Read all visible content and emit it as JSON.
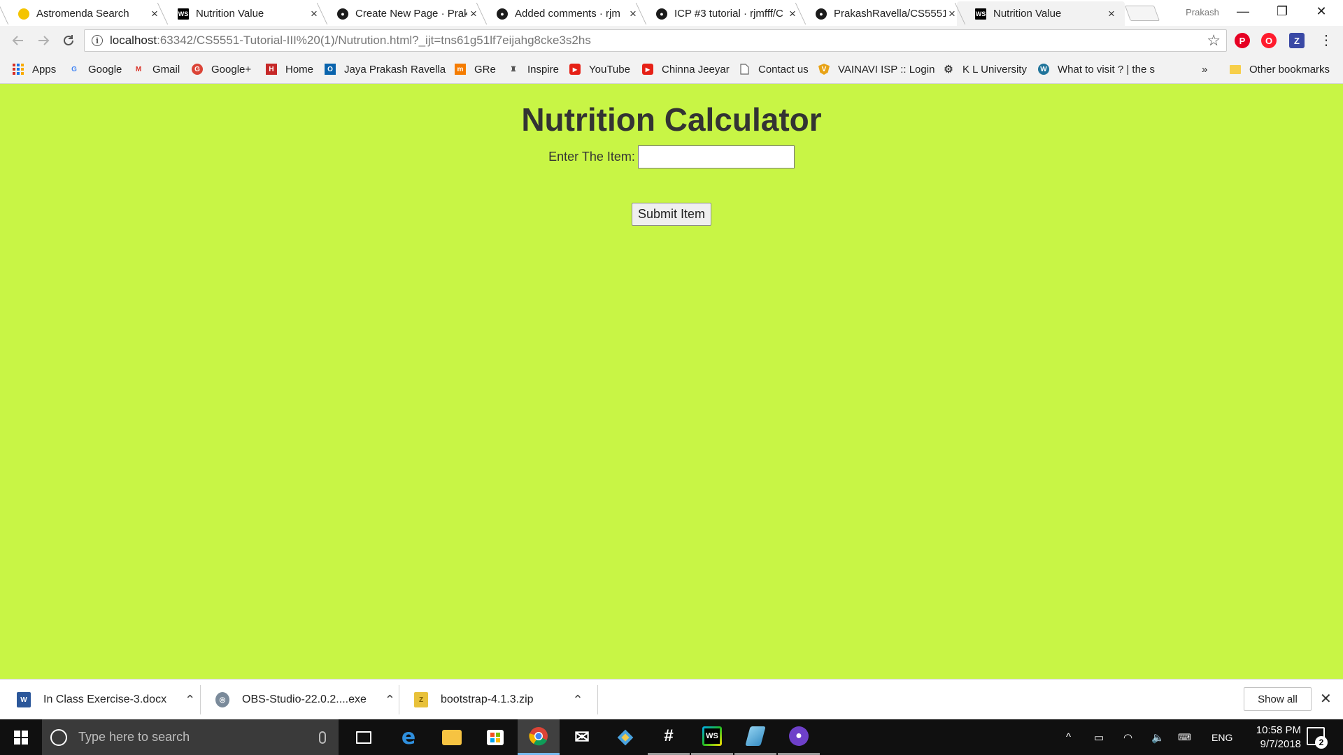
{
  "browser": {
    "tabs": [
      {
        "title": "Astromenda Search",
        "favicon": "astromenda-icon",
        "active": false
      },
      {
        "title": "Nutrition Value",
        "favicon": "webstorm-icon",
        "active": false
      },
      {
        "title": "Create New Page · Prak",
        "favicon": "github-icon",
        "active": false
      },
      {
        "title": "Added comments · rjm",
        "favicon": "github-icon",
        "active": false
      },
      {
        "title": "ICP #3 tutorial · rjmfff/C",
        "favicon": "github-icon",
        "active": false
      },
      {
        "title": "PrakashRavella/CS5551",
        "favicon": "github-icon",
        "active": false
      },
      {
        "title": "Nutrition Value",
        "favicon": "webstorm-icon",
        "active": true
      }
    ],
    "tab_close": "×",
    "profile_name": "Prakash",
    "window_controls": {
      "minimize": "—",
      "restore": "❐",
      "close": "✕"
    },
    "url": {
      "host": "localhost",
      "rest": ":63342/CS5551-Tutorial-III%20(1)/Nutrution.html?_ijt=tns61g51lf7eijahg8cke3s2hs"
    }
  },
  "bookmarks": [
    {
      "label": "Apps",
      "icon": "apps-grid-icon"
    },
    {
      "label": "Google",
      "icon": "google-icon",
      "color": "#4285f4",
      "glyph": "G"
    },
    {
      "label": "Gmail",
      "icon": "gmail-icon",
      "color": "#d93025",
      "glyph": "M"
    },
    {
      "label": "Google+",
      "icon": "google-plus-icon",
      "color": "#db4437",
      "glyph": "G"
    },
    {
      "label": "Home",
      "icon": "home-icon",
      "color": "#c62828",
      "glyph": "H"
    },
    {
      "label": "Jaya Prakash Ravella",
      "icon": "outlook-icon",
      "color": "#0a64ad",
      "glyph": "O"
    },
    {
      "label": "GRe",
      "icon": "gre-icon",
      "color": "#f57c00",
      "glyph": "m"
    },
    {
      "label": "Inspire",
      "icon": "inspire-icon",
      "color": "#555555",
      "glyph": "I"
    },
    {
      "label": "YouTube",
      "icon": "youtube-icon",
      "color": "#e62117",
      "glyph": "▶"
    },
    {
      "label": "Chinna Jeeyar",
      "icon": "youtube-icon",
      "color": "#e62117",
      "glyph": "▶"
    },
    {
      "label": "Contact us",
      "icon": "page-icon",
      "color": "#777777",
      "glyph": ""
    },
    {
      "label": "VAINAVI ISP :: Login",
      "icon": "shield-icon",
      "color": "#e8a317",
      "glyph": "V"
    },
    {
      "label": "K L University",
      "icon": "gear-icon",
      "color": "#444444",
      "glyph": "⚙"
    },
    {
      "label": "What to visit ? | the s",
      "icon": "wordpress-icon",
      "color": "#21759b",
      "glyph": "W"
    }
  ],
  "bookmarks_overflow": "»",
  "other_bookmarks": "Other bookmarks",
  "page": {
    "heading": "Nutrition Calculator",
    "item_label": "Enter The Item:",
    "item_value": "",
    "submit_label": "Submit Item",
    "background": "#c8f545"
  },
  "downloads": [
    {
      "name": "In Class Exercise-3.docx",
      "icon": "word-doc-icon",
      "color": "#2b579a",
      "glyph": "W"
    },
    {
      "name": "OBS-Studio-22.0.2....exe",
      "icon": "installer-icon",
      "color": "#7a8a9a",
      "glyph": "◎"
    },
    {
      "name": "bootstrap-4.1.3.zip",
      "icon": "zip-icon",
      "color": "#e8c13a",
      "glyph": "Z"
    }
  ],
  "show_all_label": "Show all",
  "taskbar": {
    "search_placeholder": "Type here to search",
    "apps": [
      {
        "name": "task-view",
        "glyph": "▭",
        "color": "transparent"
      },
      {
        "name": "edge",
        "glyph": "e",
        "color": "transparent",
        "fg": "#2f8fdd"
      },
      {
        "name": "file-explorer",
        "glyph": "📁",
        "color": "transparent"
      },
      {
        "name": "store",
        "glyph": "🛍",
        "color": "transparent"
      },
      {
        "name": "chrome",
        "glyph": "◉",
        "color": "transparent"
      },
      {
        "name": "mail",
        "glyph": "✉",
        "color": "transparent"
      },
      {
        "name": "git",
        "glyph": "◆",
        "color": "transparent"
      },
      {
        "name": "slack",
        "glyph": "#",
        "color": "transparent"
      },
      {
        "name": "webstorm",
        "glyph": "WS",
        "color": "#1d1d1d"
      },
      {
        "name": "paint",
        "glyph": "◇",
        "color": "transparent"
      },
      {
        "name": "github-desktop",
        "glyph": "◕",
        "color": "#6e40c9"
      }
    ],
    "language": "ENG",
    "time": "10:58 PM",
    "date": "9/7/2018",
    "notification_count": "2"
  }
}
